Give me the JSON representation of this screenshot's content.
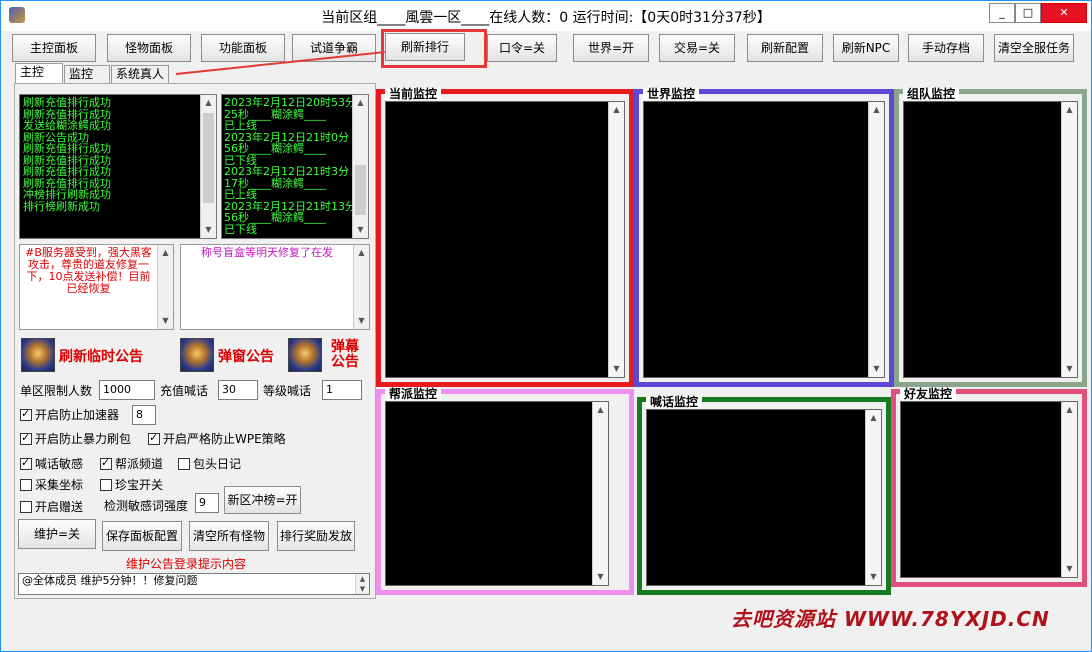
{
  "window": {
    "title": "当前区组____風雲一区____在线人数：0  运行时间:【0天0时31分37秒】",
    "controls": [
      "_",
      "□",
      "✕"
    ]
  },
  "toolbar": [
    "主控面板",
    "怪物面板",
    "功能面板",
    "试道争霸",
    "刷新排行",
    "口令=关",
    "世界=开",
    "交易=关",
    "刷新配置",
    "刷新NPC",
    "手动存档",
    "清空全服任务"
  ],
  "tabs": [
    "主控",
    "监控",
    "系统真人"
  ],
  "log_left": [
    "刷新充值排行成功",
    "刷新充值排行成功",
    "发送给糊涂鳄成功",
    "刷新公告成功",
    "刷新充值排行成功",
    "刷新充值排行成功",
    "刷新充值排行成功",
    "刷新充值排行成功",
    "冲榜排行刷新成功",
    "排行榜刷新成功"
  ],
  "log_right": [
    "2023年2月12日20时53分",
    "25秒____糊涂鳄____",
    "已上线",
    "2023年2月12日21时0分",
    "56秒____糊涂鳄____",
    "已下线",
    "2023年2月12日21时3分",
    "17秒____糊涂鳄____",
    "已上线",
    "2023年2月12日21时13分",
    "56秒____糊涂鳄____",
    "已下线"
  ],
  "notices": {
    "left": "#B服务器受到，强大黑客攻击，尊贵的道友修复一下，10点发送补偿！目前已经恢复",
    "right": "称号盲盒等明天修复了在发"
  },
  "banners": [
    "刷新临时公告",
    "弹窗公告",
    "弹幕公告"
  ],
  "settings": {
    "limit_label": "单区限制人数",
    "limit_value": "1000",
    "recharge_label": "充值喊话",
    "recharge_value": "30",
    "level_label": "等级喊话",
    "level_value": "1",
    "speed_label": "开启防止加速器",
    "speed_value": "8",
    "brute_label": "开启防止暴力刷包",
    "wpe_label": "开启严格防止WPE策略",
    "sensitive_label": "喊话敏感",
    "guild_label": "帮派频道",
    "head_label": "包头日记",
    "coords_label": "采集坐标",
    "treasure_label": "珍宝开关",
    "gift_label": "开启赠送",
    "detect_label": "检测敏感词强度",
    "detect_value": "9",
    "newzone_label": "新区冲榜=开"
  },
  "checkboxes": {
    "speed": true,
    "brute": true,
    "wpe": true,
    "sensitive": true,
    "guild": true,
    "head": false,
    "coords": false,
    "treasure": false,
    "gift": false
  },
  "actions": [
    "维护=关",
    "保存面板配置",
    "清空所有怪物",
    "排行奖励发放"
  ],
  "hint": "维护公告登录提示内容",
  "maintenance_text": "@全体成员 维护5分钟！！修复问题",
  "monitors": [
    {
      "label": "当前监控",
      "color": "#e81c1c"
    },
    {
      "label": "世界监控",
      "color": "#5b48d6"
    },
    {
      "label": "组队监控",
      "color": "#8aa58a"
    },
    {
      "label": "帮派监控",
      "color": "#ee90ee"
    },
    {
      "label": "喊话监控",
      "color": "#167a1e"
    },
    {
      "label": "好友监控",
      "color": "#e0507a"
    }
  ],
  "watermark": "去吧资源站 WWW.78YXJD.CN"
}
